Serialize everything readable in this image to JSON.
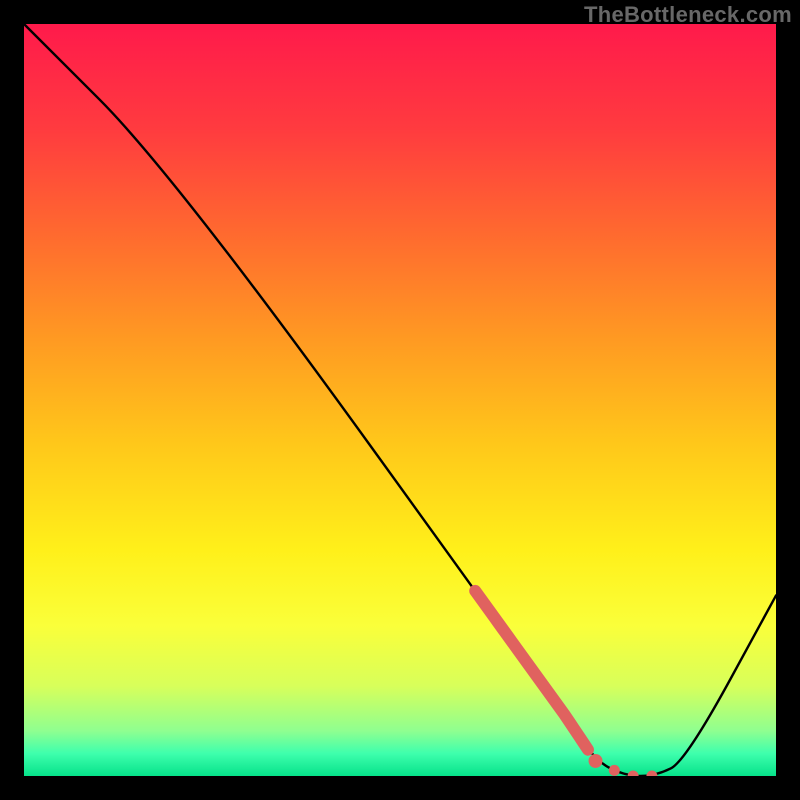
{
  "watermark": "TheBottleneck.com",
  "chart_data": {
    "type": "line",
    "title": "",
    "xlabel": "",
    "ylabel": "",
    "xlim": [
      0,
      100
    ],
    "ylim": [
      0,
      100
    ],
    "x": [
      0,
      20,
      72,
      76,
      80,
      84,
      88,
      100
    ],
    "values": [
      100,
      80,
      8,
      2,
      0,
      0,
      2,
      24
    ],
    "highlight_segment": {
      "x_start": 60,
      "x_end": 75,
      "color": "#e0625f"
    },
    "highlight_dots": {
      "x": [
        76,
        78.5,
        81,
        83.5
      ],
      "color": "#e0625f"
    },
    "background_gradient_stops": [
      {
        "pct": 0,
        "color": "#ff1a4b"
      },
      {
        "pct": 14,
        "color": "#ff3b3f"
      },
      {
        "pct": 28,
        "color": "#ff6a2f"
      },
      {
        "pct": 42,
        "color": "#ff9a22"
      },
      {
        "pct": 56,
        "color": "#ffc81a"
      },
      {
        "pct": 70,
        "color": "#fff01a"
      },
      {
        "pct": 80,
        "color": "#faff3a"
      },
      {
        "pct": 88,
        "color": "#d8ff5a"
      },
      {
        "pct": 94,
        "color": "#8fff90"
      },
      {
        "pct": 97,
        "color": "#3effad"
      },
      {
        "pct": 100,
        "color": "#06e28a"
      }
    ]
  }
}
